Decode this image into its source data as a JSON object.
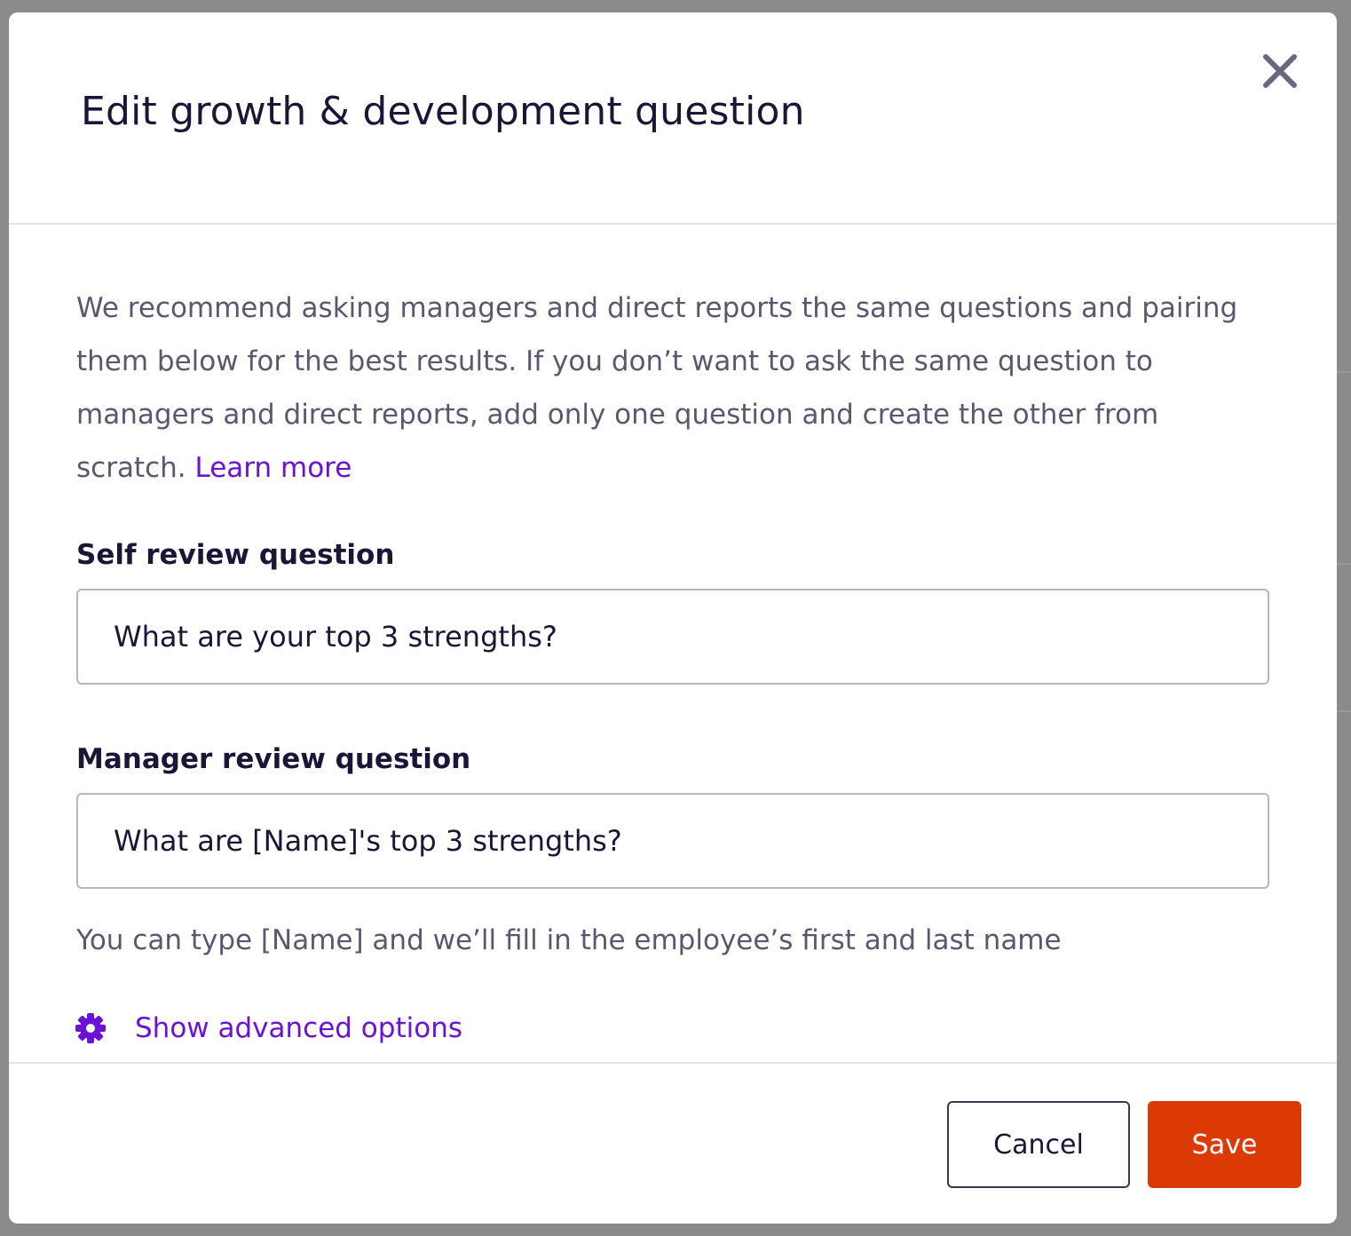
{
  "modal": {
    "title": "Edit growth & development question",
    "close_icon": "close-icon",
    "description_text": "We recommend asking managers and direct reports the same questions and pairing them below for the best results. If you don’t want to ask the same question to managers and direct reports, add only one question and create the other from scratch. ",
    "learn_more_label": "Learn more",
    "self_review": {
      "label": "Self review question",
      "value": "What are your top 3 strengths?"
    },
    "manager_review": {
      "label": "Manager review question",
      "value": "What are [Name]'s top 3 strengths?",
      "helper": "You can type [Name] and we’ll fill in the employee’s first and last name"
    },
    "advanced": {
      "icon": "gear-icon",
      "label": "Show advanced options"
    },
    "footer": {
      "cancel_label": "Cancel",
      "save_label": "Save"
    }
  },
  "colors": {
    "accent": "#6b12d6",
    "primary_button": "#dc3a05",
    "title_text": "#1c1537",
    "body_text": "#5c5771"
  }
}
